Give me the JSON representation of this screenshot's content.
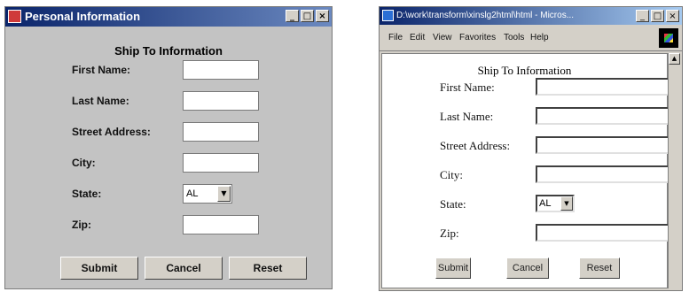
{
  "left_window": {
    "title": "Personal Information",
    "controls": {
      "minimize": "_",
      "maximize": "□",
      "close": "×"
    },
    "heading": "Ship To Information",
    "fields": {
      "first_name_label": "First Name:",
      "last_name_label": "Last Name:",
      "street_address_label": "Street Address:",
      "city_label": "City:",
      "state_label": "State:",
      "state_value": "AL",
      "zip_label": "Zip:"
    },
    "buttons": {
      "submit": "Submit",
      "cancel": "Cancel",
      "reset": "Reset"
    }
  },
  "right_window": {
    "title": "D:\\work\\transform\\xinslg2html\\html - Micros...",
    "controls": {
      "minimize": "_",
      "maximize": "□",
      "close": "×"
    },
    "menu": {
      "file": "File",
      "edit": "Edit",
      "view": "View",
      "favorites": "Favorites",
      "tools": "Tools",
      "help": "Help"
    },
    "heading": "Ship To Information",
    "fields": {
      "first_name_label": "First Name:",
      "last_name_label": "Last Name:",
      "street_address_label": "Street Address:",
      "city_label": "City:",
      "state_label": "State:",
      "state_value": "AL",
      "zip_label": "Zip:"
    },
    "buttons": {
      "submit": "Submit",
      "cancel": "Cancel",
      "reset": "Reset"
    }
  }
}
